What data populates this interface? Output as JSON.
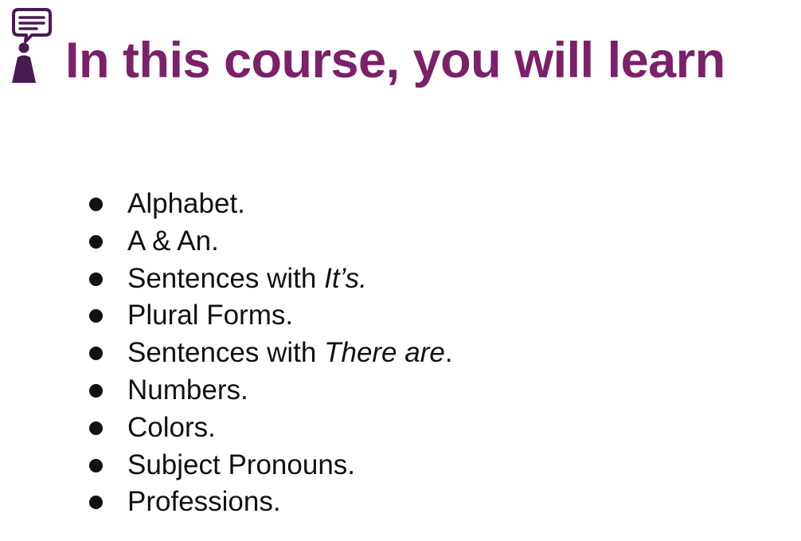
{
  "brand": {
    "logo_icon": "person-with-speech-bubble-icon",
    "accent_color": "#7b2069",
    "logo_color": "#4a1a52"
  },
  "slide": {
    "title": "In this course, you will learn",
    "topics": [
      {
        "text": "Alphabet.",
        "emphasis": "",
        "suffix": ""
      },
      {
        "text": "A & An.",
        "emphasis": "",
        "suffix": ""
      },
      {
        "text": "Sentences with ",
        "emphasis": "It’s",
        "suffix": "."
      },
      {
        "text": "Plural Forms.",
        "emphasis": "",
        "suffix": ""
      },
      {
        "text": "Sentences with ",
        "emphasis": "There are",
        "suffix": "."
      },
      {
        "text": "Numbers.",
        "emphasis": "",
        "suffix": ""
      },
      {
        "text": "Colors.",
        "emphasis": "",
        "suffix": ""
      },
      {
        "text": "Subject Pronouns.",
        "emphasis": "",
        "suffix": ""
      },
      {
        "text": "Professions.",
        "emphasis": "",
        "suffix": ""
      }
    ]
  }
}
